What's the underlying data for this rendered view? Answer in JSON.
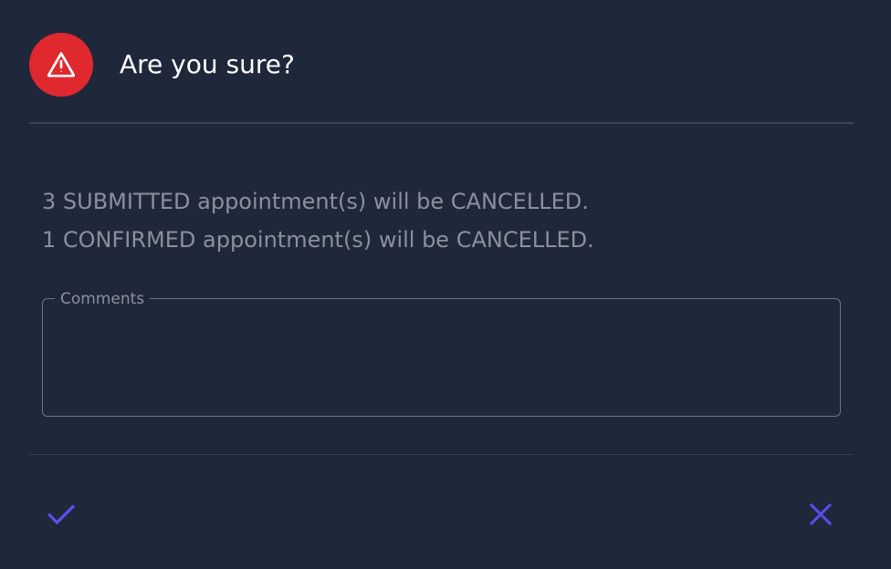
{
  "dialog": {
    "title": "Are you sure?",
    "icon": "warning-triangle-icon",
    "messages": [
      "3 SUBMITTED appointment(s) will be CANCELLED.",
      "1 CONFIRMED appointment(s) will be CANCELLED."
    ],
    "comments": {
      "label": "Comments",
      "value": ""
    },
    "actions": {
      "confirm_icon": "check-icon",
      "cancel_icon": "close-icon"
    }
  },
  "colors": {
    "background": "#1f283a",
    "warning": "#e0282f",
    "accent": "#5a4ff0",
    "text_muted": "#8a909c"
  }
}
